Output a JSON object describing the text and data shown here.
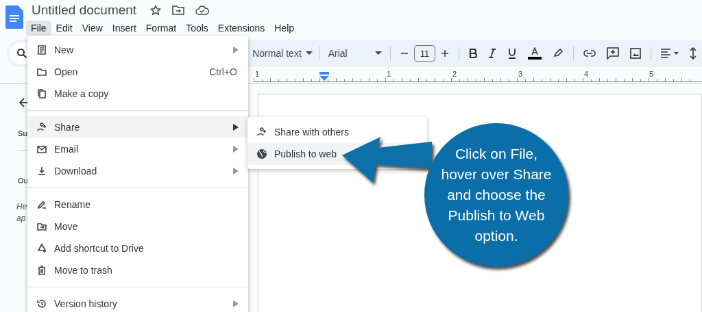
{
  "document": {
    "title": "Untitled document"
  },
  "menubar": [
    {
      "label": "File",
      "selected": true
    },
    {
      "label": "Edit",
      "selected": false
    },
    {
      "label": "View",
      "selected": false
    },
    {
      "label": "Insert",
      "selected": false
    },
    {
      "label": "Format",
      "selected": false
    },
    {
      "label": "Tools",
      "selected": false
    },
    {
      "label": "Extensions",
      "selected": false
    },
    {
      "label": "Help",
      "selected": false
    }
  ],
  "toolbar": {
    "style": "Normal text",
    "font": "Arial",
    "font_size": "11"
  },
  "ruler": [
    "1",
    "1",
    "2",
    "3",
    "4",
    "5"
  ],
  "sidebar": {
    "fragments": [
      {
        "text": "Su",
        "kind": "heading"
      },
      {
        "text": "Ou",
        "kind": "heading"
      },
      {
        "text": "He",
        "kind": "hint"
      },
      {
        "text": "ap",
        "kind": "hint"
      }
    ]
  },
  "file_menu": [
    [
      {
        "label": "New",
        "has_submenu": true,
        "selected": false
      },
      {
        "label": "Open",
        "shortcut": "Ctrl+O",
        "has_submenu": false,
        "selected": false
      },
      {
        "label": "Make a copy",
        "has_submenu": false,
        "selected": false
      }
    ],
    [
      {
        "label": "Share",
        "has_submenu": true,
        "selected": true
      },
      {
        "label": "Email",
        "has_submenu": true,
        "selected": false
      },
      {
        "label": "Download",
        "has_submenu": true,
        "selected": false
      }
    ],
    [
      {
        "label": "Rename",
        "has_submenu": false,
        "selected": false
      },
      {
        "label": "Move",
        "has_submenu": false,
        "selected": false
      },
      {
        "label": "Add shortcut to Drive",
        "has_submenu": false,
        "selected": false
      },
      {
        "label": "Move to trash",
        "has_submenu": false,
        "selected": false
      }
    ],
    [
      {
        "label": "Version history",
        "has_submenu": true,
        "selected": false
      }
    ]
  ],
  "share_submenu": [
    {
      "label": "Share with others",
      "selected": false
    },
    {
      "label": "Publish to web",
      "selected": true
    }
  ],
  "callout": {
    "lines": [
      "Click on File,",
      "hover over Share",
      "and choose the",
      "Publish to Web",
      "option."
    ]
  }
}
